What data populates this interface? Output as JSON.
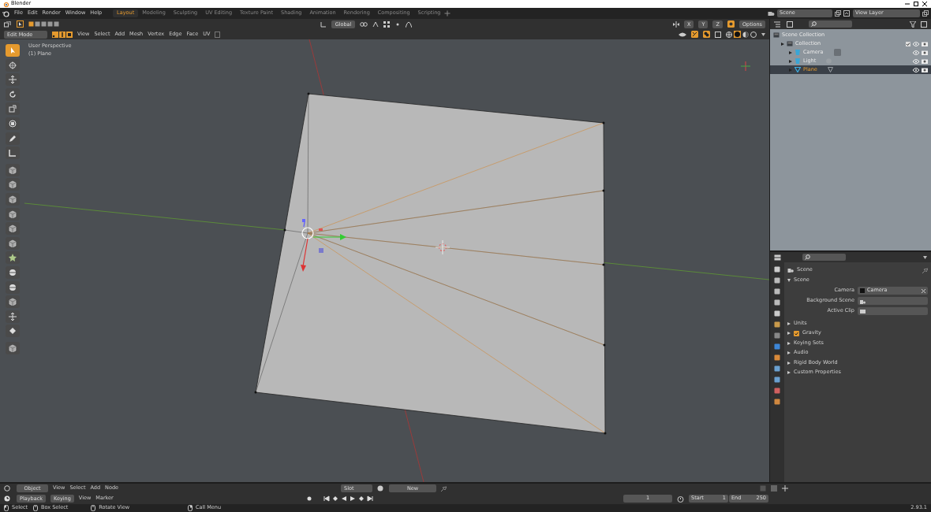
{
  "window": {
    "title": "Blender"
  },
  "menu": [
    "File",
    "Edit",
    "Render",
    "Window",
    "Help"
  ],
  "workspaces": [
    {
      "label": "Layout",
      "selected": true
    },
    {
      "label": "Modeling",
      "selected": false
    },
    {
      "label": "Sculpting",
      "selected": false
    },
    {
      "label": "UV Editing",
      "selected": false
    },
    {
      "label": "Texture Paint",
      "selected": false
    },
    {
      "label": "Shading",
      "selected": false
    },
    {
      "label": "Animation",
      "selected": false
    },
    {
      "label": "Rendering",
      "selected": false
    },
    {
      "label": "Compositing",
      "selected": false
    },
    {
      "label": "Scripting",
      "selected": false
    }
  ],
  "scene_selector": {
    "scene": "Scene",
    "view_layer": "View Layer"
  },
  "viewport_header": {
    "orientation": "Global",
    "axes": [
      "X",
      "Y",
      "Z"
    ],
    "options": "Options",
    "mode": "Edit Mode",
    "menus": [
      "View",
      "Select",
      "Add",
      "Mesh",
      "Vertex",
      "Edge",
      "Face",
      "UV"
    ]
  },
  "viewport": {
    "view_name": "User Perspective",
    "object_label": "(1) Plane"
  },
  "tools": [
    {
      "selected": true
    },
    {
      "selected": false
    },
    {
      "selected": false
    },
    {
      "selected": false
    },
    {
      "selected": false
    },
    {
      "selected": false
    },
    {
      "selected": false
    },
    {
      "selected": false
    },
    {
      "selected": false
    },
    {
      "selected": false
    },
    {
      "selected": false
    },
    {
      "selected": false
    },
    {
      "selected": false
    },
    {
      "selected": false
    },
    {
      "selected": false
    },
    {
      "selected": false
    },
    {
      "selected": false
    },
    {
      "selected": false
    },
    {
      "selected": false
    },
    {
      "selected": false
    },
    {
      "selected": false
    }
  ],
  "outliner": {
    "items": [
      {
        "label": "Scene Collection",
        "selected": false,
        "children": [
          {
            "label": "Collection",
            "selected": false,
            "children": [
              {
                "label": "Camera",
                "selected": false
              },
              {
                "label": "Light",
                "selected": false
              },
              {
                "label": "Plane",
                "selected": true
              }
            ]
          }
        ]
      }
    ]
  },
  "properties": {
    "context": "Scene",
    "section": "Scene",
    "fields": [
      {
        "label": "Camera",
        "value": "Camera"
      },
      {
        "label": "Background Scene"
      },
      {
        "label": "Active Clip"
      }
    ],
    "panels": [
      {
        "label": "Units",
        "kind": "plain"
      },
      {
        "label": "Gravity",
        "kind": "checkbox",
        "checked": true
      },
      {
        "label": "Keying Sets",
        "kind": "plain"
      },
      {
        "label": "Audio",
        "kind": "plain"
      },
      {
        "label": "Rigid Body World",
        "kind": "plain"
      },
      {
        "label": "Custom Properties",
        "kind": "plain"
      }
    ]
  },
  "shader_header": {
    "mode": "Object",
    "menus": [
      "View",
      "Select",
      "Add",
      "Node"
    ],
    "slot": "Slot",
    "new": "New"
  },
  "timeline": {
    "playback": "Playback",
    "keying": "Keying",
    "menus": [
      "View",
      "Marker"
    ],
    "current_frame": "1",
    "start_label": "Start",
    "start": "1",
    "end_label": "End",
    "end": "250"
  },
  "status_bar": {
    "items": [
      "Select",
      "Box Select",
      "Rotate View",
      "Call Menu"
    ],
    "version": "2.93.1"
  }
}
